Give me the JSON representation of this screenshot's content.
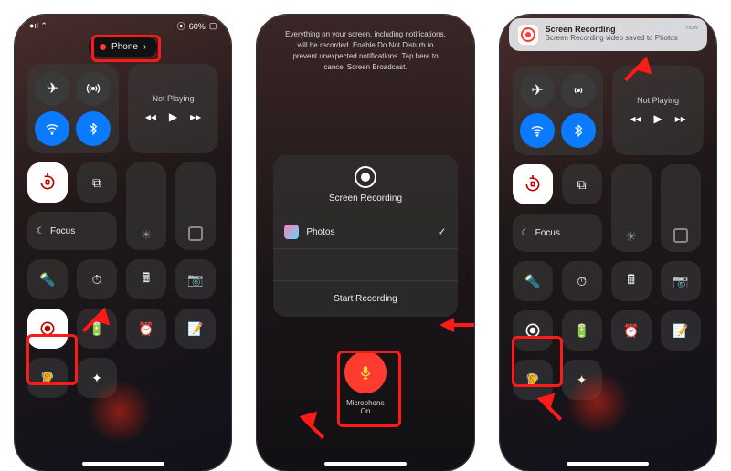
{
  "status": {
    "battery": "60%"
  },
  "pill": {
    "label": "Phone"
  },
  "controlCenter": {
    "media": {
      "title": "Not Playing"
    },
    "focus": "Focus"
  },
  "screen2": {
    "instruction": "Everything on your screen, including notifications, will be recorded. Enable Do Not Disturb to prevent unexpected notifications. Tap here to cancel Screen Broadcast.",
    "cardTitle": "Screen Recording",
    "option": "Photos",
    "start": "Start Recording",
    "micLabel": "Microphone",
    "micState": "On"
  },
  "screen3": {
    "notifTitle": "Screen Recording",
    "notifBody": "Screen Recording video saved to Photos",
    "notifWhen": "now"
  }
}
